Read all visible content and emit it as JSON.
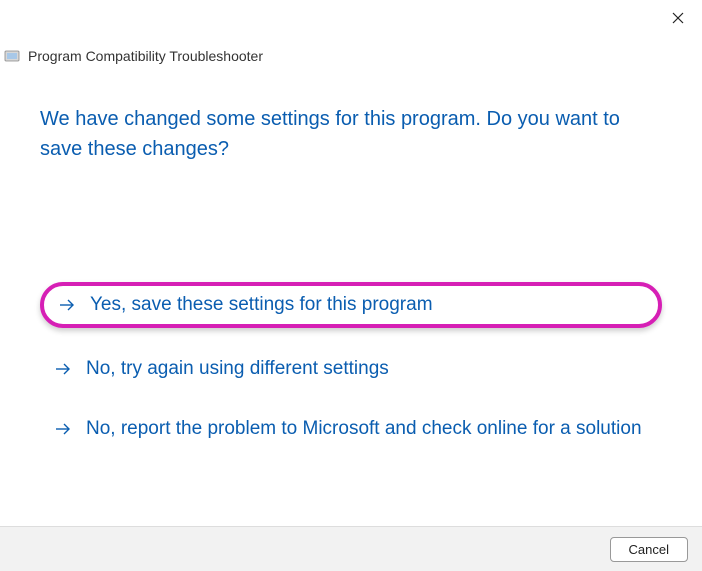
{
  "window": {
    "title": "Program Compatibility Troubleshooter"
  },
  "heading": "We have changed some settings for this program. Do you want to save these changes?",
  "options": [
    {
      "label": "Yes, save these settings for this program",
      "highlighted": true
    },
    {
      "label": "No, try again using different settings",
      "highlighted": false
    },
    {
      "label": "No, report the problem to Microsoft and check online for a solution",
      "highlighted": false
    }
  ],
  "footer": {
    "cancel_label": "Cancel"
  }
}
